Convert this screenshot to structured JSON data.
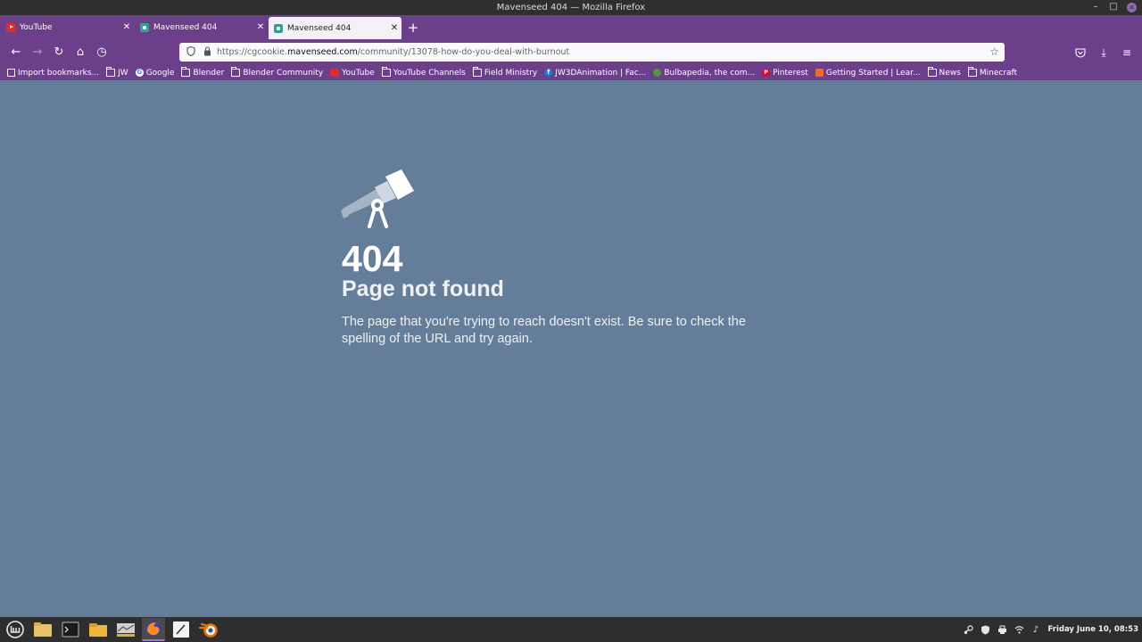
{
  "window": {
    "title": "Mavenseed 404 — Mozilla Firefox",
    "minimize_glyph": "–",
    "maximize_glyph": "□",
    "close_glyph": "✕"
  },
  "tabs": [
    {
      "label": "YouTube",
      "favicon": "youtube-icon",
      "active": false,
      "close": "✕"
    },
    {
      "label": "Mavenseed 404",
      "favicon": "mavenseed-icon",
      "active": false,
      "close": "✕"
    },
    {
      "label": "Mavenseed 404",
      "favicon": "mavenseed-icon",
      "active": true,
      "close": "✕"
    }
  ],
  "newtab_glyph": "+",
  "nav": {
    "back": "←",
    "forward": "→",
    "reload": "↻",
    "home": "⌂",
    "history": "◷",
    "url_prefix": "https://cgcookie.",
    "url_host": "mavenseed.com",
    "url_path": "/community/13078-how-do-you-deal-with-burnout",
    "bookmark_star": "☆",
    "pocket": "♡",
    "downloads": "⤓",
    "menu": "≡"
  },
  "bookmarks": [
    {
      "label": "Import bookmarks...",
      "icon": "import-icon"
    },
    {
      "label": "JW",
      "icon": "folder-icon"
    },
    {
      "label": "Google",
      "icon": "google-icon"
    },
    {
      "label": "Blender",
      "icon": "folder-icon"
    },
    {
      "label": "Blender Community",
      "icon": "folder-icon"
    },
    {
      "label": "YouTube",
      "icon": "youtube-icon"
    },
    {
      "label": "YouTube Channels",
      "icon": "folder-icon"
    },
    {
      "label": "Field Ministry",
      "icon": "folder-icon"
    },
    {
      "label": "JW3DAnimation | Fac...",
      "icon": "facebook-icon"
    },
    {
      "label": "Bulbapedia, the com...",
      "icon": "bulbapedia-icon"
    },
    {
      "label": "Pinterest",
      "icon": "pinterest-icon"
    },
    {
      "label": "Getting Started | Lear...",
      "icon": "getting-started-icon"
    },
    {
      "label": "News",
      "icon": "folder-icon"
    },
    {
      "label": "Minecraft",
      "icon": "folder-icon"
    }
  ],
  "page": {
    "code": "404",
    "title": "Page not found",
    "message": "The page that you're trying to reach doesn't exist. Be sure to check the spelling of the URL and try again."
  },
  "taskbar": {
    "apps": [
      "menu-icon",
      "files-icon",
      "terminal-icon",
      "folder-icon",
      "screenshot-icon",
      "firefox-icon",
      "editor-icon",
      "blender-icon"
    ],
    "clock": "Friday June 10, 08:53"
  },
  "colors": {
    "accent": "#6b3f8a",
    "page_bg": "#647e99"
  }
}
